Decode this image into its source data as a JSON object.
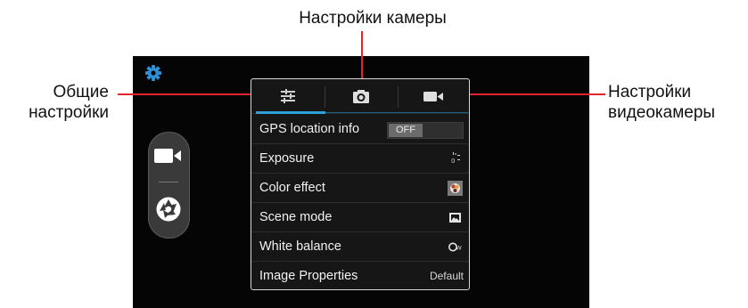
{
  "callouts": {
    "camera_settings": "Настройки камеры",
    "general_line1": "Общие",
    "general_line2": "настройки",
    "video_line1": "Настройки",
    "video_line2": "видеокамеры"
  },
  "tabs": [
    {
      "icon": "sliders-icon",
      "selected": true
    },
    {
      "icon": "camera-icon",
      "selected": false
    },
    {
      "icon": "video-camera-icon",
      "selected": false
    }
  ],
  "settings": [
    {
      "label": "GPS location info",
      "control": "toggle",
      "value": "OFF"
    },
    {
      "label": "Exposure",
      "control": "icon",
      "icon": "exposure-icon"
    },
    {
      "label": "Color effect",
      "control": "icon",
      "icon": "color-effect-thumbnail"
    },
    {
      "label": "Scene mode",
      "control": "icon",
      "icon": "scene-mode-icon"
    },
    {
      "label": "White balance",
      "control": "icon",
      "icon": "white-balance-auto-icon"
    },
    {
      "label": "Image Properties",
      "control": "value",
      "value": "Default"
    }
  ],
  "side_controls": [
    {
      "icon": "settings-gear-icon"
    },
    {
      "icon": "video-mode-icon"
    },
    {
      "icon": "shutter-icon"
    }
  ],
  "colors": {
    "accent": "#2a9fd8",
    "callout_line": "#e2262b",
    "screen_bg": "#050505"
  }
}
